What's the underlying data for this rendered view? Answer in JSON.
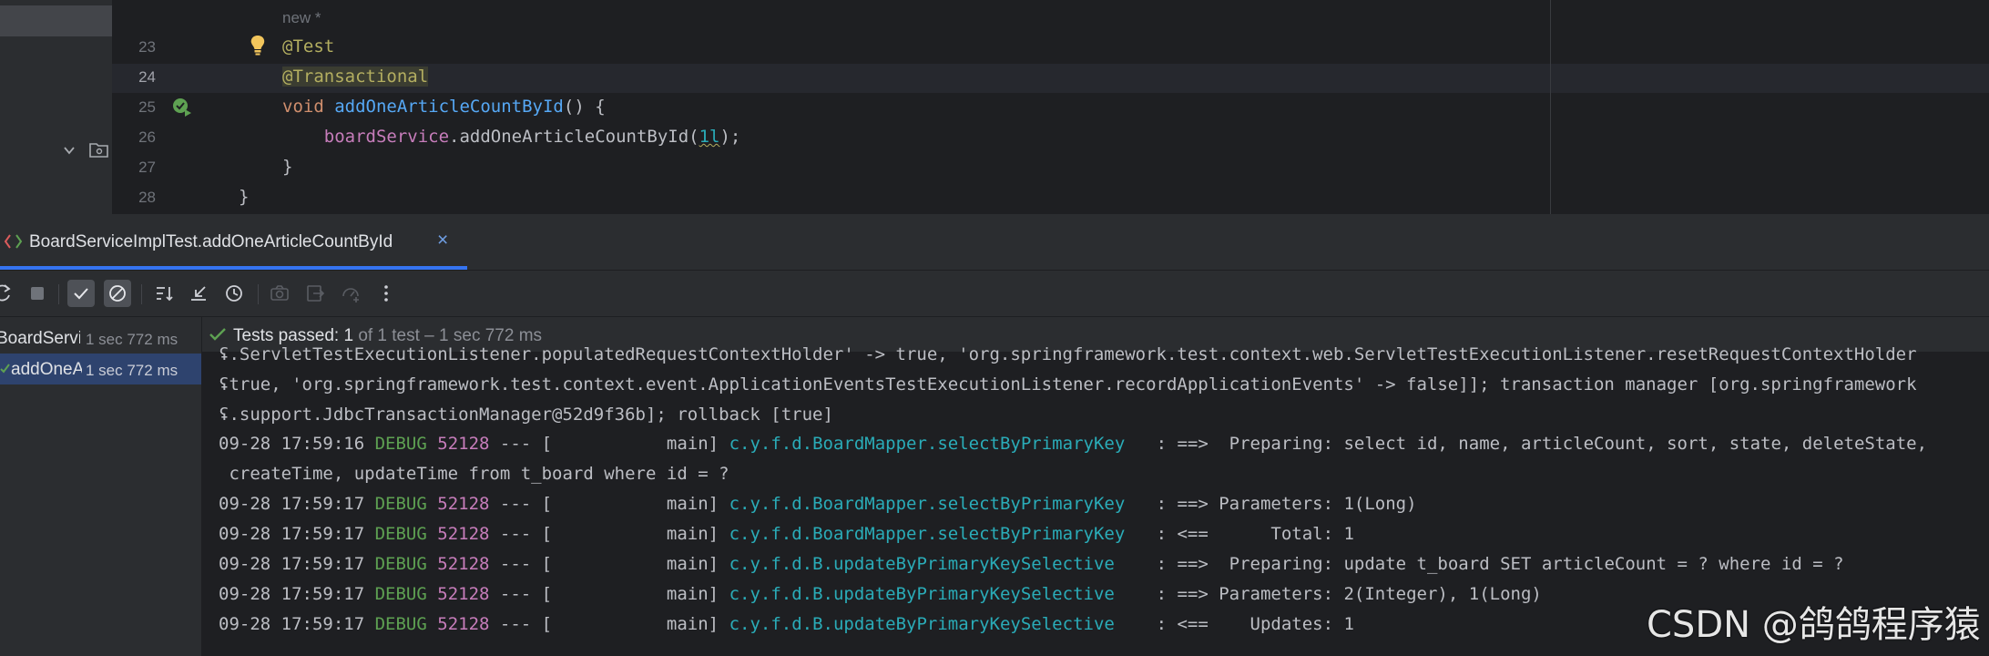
{
  "editor": {
    "hint": "new *",
    "line_numbers": [
      "23",
      "24",
      "25",
      "26",
      "27",
      "28"
    ],
    "code": {
      "l23": "@Test",
      "l24": "@Transactional",
      "l25_kw": "void",
      "l25_fn": "addOneArticleCountById",
      "l25_rest": "() {",
      "l26_field": "boardService",
      "l26_call": ".addOneArticleCountById(",
      "l26_arg": "1l",
      "l26_end": ");",
      "l27": "}",
      "l28": "}"
    }
  },
  "run_panel": {
    "tab_label": "BoardServiceImplTest.addOneArticleCountById",
    "tab_close": "×",
    "status": {
      "label": "Tests passed:",
      "count": "1",
      "detail": "of 1 test – 1 sec 772 ms"
    },
    "tree": [
      {
        "name": "BoardServiceImplTest",
        "time": "1 sec 772 ms"
      },
      {
        "name": "addOneArticleCountById",
        "time": "1 sec 772 ms"
      }
    ],
    "console_wrapped": [
      "ʢ.ServletTestExecutionListener.populatedRequestContextHolder' -> true, 'org.springframework.test.context.web.ServletTestExecutionListener.resetRequestContextHolder",
      "ʢtrue, 'org.springframework.test.context.event.ApplicationEventsTestExecutionListener.recordApplicationEvents' -> false]]; transaction manager [org.springframework",
      "ʢ.support.JdbcTransactionManager@52d9f36b]; rollback [true]"
    ],
    "log_lines": [
      {
        "ts": "09-28 17:59:16",
        "level": "DEBUG",
        "pid": "52128",
        "thread": " --- [           main] ",
        "logger": "c.y.f.d.BoardMapper.selectByPrimaryKey  ",
        "msg": " : ==>  Preparing: select id, name, articleCount, sort, state, deleteState,"
      },
      {
        "ts": "",
        "level": "",
        "pid": "",
        "thread": "",
        "logger": "",
        "msg": " createTime, updateTime from t_board where id = ?"
      },
      {
        "ts": "09-28 17:59:17",
        "level": "DEBUG",
        "pid": "52128",
        "thread": " --- [           main] ",
        "logger": "c.y.f.d.BoardMapper.selectByPrimaryKey  ",
        "msg": " : ==> Parameters: 1(Long)"
      },
      {
        "ts": "09-28 17:59:17",
        "level": "DEBUG",
        "pid": "52128",
        "thread": " --- [           main] ",
        "logger": "c.y.f.d.BoardMapper.selectByPrimaryKey  ",
        "msg": " : <==      Total: 1"
      },
      {
        "ts": "09-28 17:59:17",
        "level": "DEBUG",
        "pid": "52128",
        "thread": " --- [           main] ",
        "logger": "c.y.f.d.B.updateByPrimaryKeySelective   ",
        "msg": " : ==>  Preparing: update t_board SET articleCount = ? where id = ?"
      },
      {
        "ts": "09-28 17:59:17",
        "level": "DEBUG",
        "pid": "52128",
        "thread": " --- [           main] ",
        "logger": "c.y.f.d.B.updateByPrimaryKeySelective   ",
        "msg": " : ==> Parameters: 2(Integer), 1(Long)"
      },
      {
        "ts": "09-28 17:59:17",
        "level": "DEBUG",
        "pid": "52128",
        "thread": " --- [           main] ",
        "logger": "c.y.f.d.B.updateByPrimaryKeySelective   ",
        "msg": " : <==    Updates: 1"
      }
    ]
  },
  "watermark": "CSDN @鸽鸽程序猿",
  "colors": {
    "background": "#1e1f22",
    "panel": "#2b2d30",
    "accent": "#3574f0",
    "pass_green": "#5ea152",
    "annotation": "#b3ae60",
    "keyword": "#cf8e6d",
    "method": "#56a8f5",
    "field": "#c77dbb",
    "logger": "#2aacb8"
  },
  "icons": [
    "bulb-icon",
    "run-gutter-icon",
    "chevron-down-icon",
    "folder-icon",
    "rerun-icon",
    "stop-icon",
    "show-passed-icon",
    "show-ignored-icon",
    "sort-icon",
    "collapse-icon",
    "history-icon",
    "camera-icon",
    "export-icon",
    "import-icon",
    "more-icon",
    "check-icon"
  ]
}
